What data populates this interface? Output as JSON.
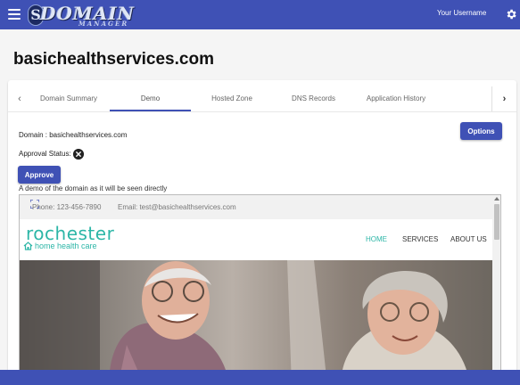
{
  "appbar": {
    "logo_title": "DOMAIN",
    "logo_subtitle": "MANAGER",
    "logo_letter": "S",
    "username": "Your Username",
    "menu_icon": "hamburger-menu-icon",
    "settings_icon": "gear-icon",
    "color": "#3f51b5"
  },
  "page": {
    "title": "basichealthservices.com"
  },
  "tabs": {
    "items": [
      "Domain Summary",
      "Demo",
      "Hosted Zone",
      "DNS Records",
      "Application History"
    ],
    "active": "Demo",
    "prev_icon": "chevron-left-icon",
    "next_icon": "chevron-right-icon",
    "prev_glyph": "‹",
    "next_glyph": "›"
  },
  "details": {
    "domain_line": "Domain : basichealthservices.com",
    "approval_label": "Approval Status:",
    "approval_icon": "x-circle-icon",
    "options_label": "Options",
    "approve_label": "Approve",
    "demo_caption": "A demo of the domain as it will be seen directly"
  },
  "preview": {
    "phone": "Phone: 123-456-7890",
    "email": "Email: test@basichealthservices.com",
    "logo_main": "rochester",
    "logo_sub": "home health care",
    "nav": [
      "HOME",
      "SERVICES",
      "ABOUT US"
    ],
    "accent": "#2db6a7",
    "hero_image": "elderly couple smiling photo"
  }
}
